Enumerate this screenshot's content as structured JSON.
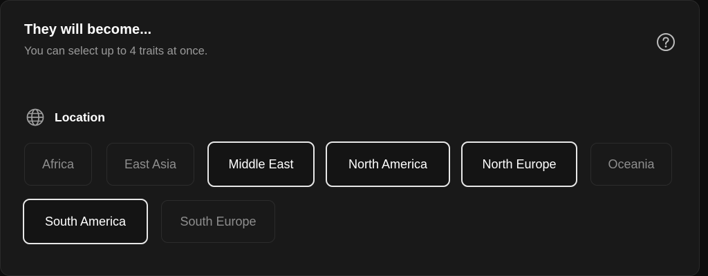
{
  "header": {
    "title": "They will become...",
    "subtitle": "You can select up to 4 traits at once.",
    "help_icon": "question-circle-icon"
  },
  "section": {
    "icon": "globe-icon",
    "label": "Location"
  },
  "chips": [
    {
      "label": "Africa",
      "selected": false
    },
    {
      "label": "East Asia",
      "selected": false
    },
    {
      "label": "Middle East",
      "selected": true
    },
    {
      "label": "North America",
      "selected": true
    },
    {
      "label": "North Europe",
      "selected": true
    },
    {
      "label": "Oceania",
      "selected": false
    },
    {
      "label": "South America",
      "selected": true
    },
    {
      "label": "South Europe",
      "selected": false
    }
  ],
  "colors": {
    "card_background": "#191919",
    "selected_border": "#e8e8e8",
    "unselected_text": "#8e8e8e",
    "selected_text": "#ffffff"
  }
}
